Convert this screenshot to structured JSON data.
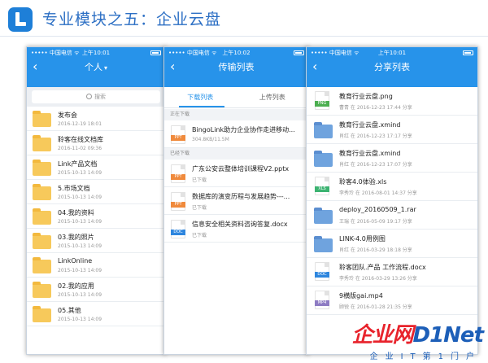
{
  "slide": {
    "title": "专业模块之五：企业云盘"
  },
  "phone1": {
    "status_left": "••••• 中国电信 ᯤ",
    "time": "上午10:01",
    "title": "个人",
    "title_caret": "▾",
    "back": "‹",
    "search_placeholder": "搜索",
    "items": [
      {
        "name": "发布会",
        "date": "2016-12-19 18:01"
      },
      {
        "name": "聆客在线文档库",
        "date": "2016-11-02 09:36"
      },
      {
        "name": "Link产品文档",
        "date": "2015-10-13 14:09"
      },
      {
        "name": "5.市场文档",
        "date": "2015-10-13 14:09"
      },
      {
        "name": "04.我的资料",
        "date": "2015-10-13 14:09"
      },
      {
        "name": "03.我的照片",
        "date": "2015-10-13 14:09"
      },
      {
        "name": "LinkOnline",
        "date": "2015-10-13 14:09"
      },
      {
        "name": "02.我的应用",
        "date": "2015-10-13 14:09"
      },
      {
        "name": "05.其他",
        "date": "2015-10-13 14:09"
      }
    ]
  },
  "phone2": {
    "status_left": "••••• 中国电信 ᯤ",
    "time": "上午10:02",
    "title": "传输列表",
    "back": "‹",
    "tab_download": "下载列表",
    "tab_upload": "上传列表",
    "section_downloading": "正在下载",
    "section_downloaded": "已经下载",
    "downloading": [
      {
        "name": "BingoLink助力企业协作走进移动...",
        "sub": "304.8KB/11.5M",
        "type": "PPT"
      }
    ],
    "downloaded": [
      {
        "name": "广东公安云整体培训课程V2.pptx",
        "sub": "已下载",
        "type": "PPT"
      },
      {
        "name": "数据库的演变历程与发展趋势---...",
        "sub": "已下载",
        "type": "PPT"
      },
      {
        "name": "信息安全相关资料咨询答复.docx",
        "sub": "已下载",
        "type": "DOC"
      }
    ]
  },
  "phone3": {
    "status_left": "••••• 中国电信 ᯤ",
    "time": "上午10:01",
    "title": "分享列表",
    "back": "‹",
    "items": [
      {
        "name": "教育行业云盘.png",
        "sub": "曹青 在 2016-12-23 17:44 分享",
        "icon": "file",
        "type": "PNG"
      },
      {
        "name": "教育行业云盘.xmind",
        "sub": "肖红 在 2016-12-23 17:17 分享",
        "icon": "folder",
        "type": ""
      },
      {
        "name": "教育行业云盘.xmind",
        "sub": "肖红 在 2016-12-23 17:07 分享",
        "icon": "folder",
        "type": ""
      },
      {
        "name": "聆客4.0体验.xls",
        "sub": "李秀玲 在 2016-08-01 14:37 分享",
        "icon": "file",
        "type": "XLS"
      },
      {
        "name": "deploy_20160509_1.rar",
        "sub": "王瑞 在 2016-05-09 19:17 分享",
        "icon": "folder",
        "type": ""
      },
      {
        "name": "LINK-4.0用例图",
        "sub": "肖红 在 2016-03-29 18:18 分享",
        "icon": "folder",
        "type": ""
      },
      {
        "name": "聆客团队.产品 工作流程.docx",
        "sub": "李秀玲 在 2016-03-29 13:26 分享",
        "icon": "file",
        "type": "DOC"
      },
      {
        "name": "9横版gai.mp4",
        "sub": "顾锐 在 2016-01-28 21:35 分享",
        "icon": "file",
        "type": "MP4"
      }
    ]
  },
  "watermark": {
    "brand_a": "企业网",
    "brand_b": "D1Net",
    "tagline": "企业IT第1门户"
  },
  "colors": {
    "accent": "#2793ea",
    "title": "#2c6fc4",
    "folder": "#f7c95b"
  }
}
